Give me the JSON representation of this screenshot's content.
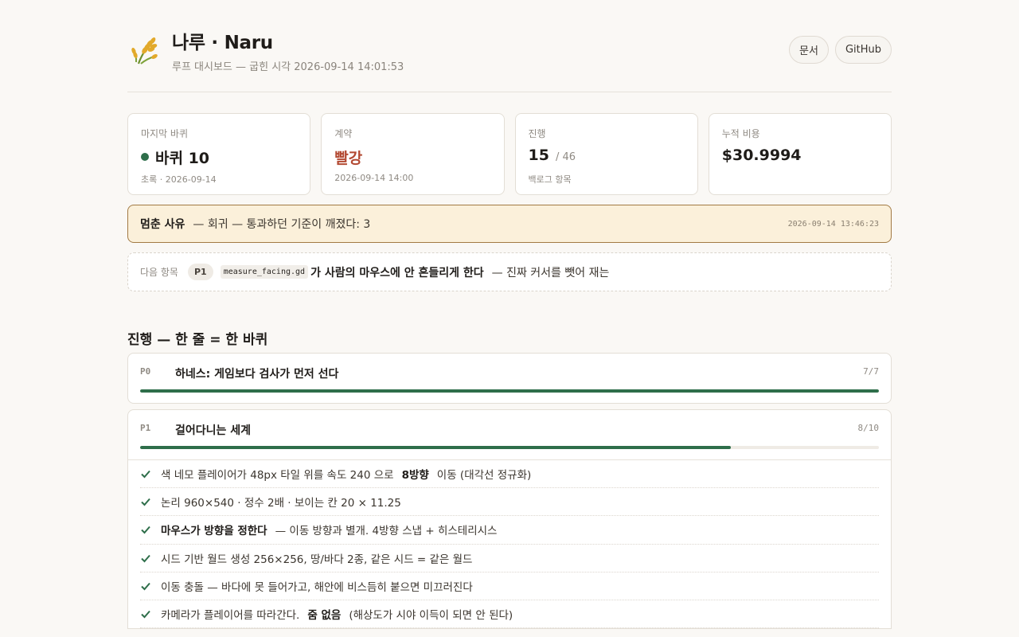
{
  "header": {
    "title": "나루 · Naru",
    "subtitle": "루프 대시보드 — 굽힌 시각 2026-09-14 14:01:53",
    "buttons": {
      "docs": "문서",
      "github": "GitHub"
    }
  },
  "cards": {
    "last_wheel": {
      "label": "마지막 바퀴",
      "value": "바퀴 10",
      "sub": "초록 · 2026-09-14",
      "status_color": "#2e6e4a"
    },
    "contract": {
      "label": "계약",
      "value": "빨강",
      "sub": "2026-09-14 14:00",
      "value_color": "#b34a33"
    },
    "progress": {
      "label": "진행",
      "value": "15",
      "total": "/ 46",
      "sub": "백로그 항목"
    },
    "cost": {
      "label": "누적 비용",
      "value": "$30.9994"
    }
  },
  "stop": {
    "label": "멈춘 사유",
    "text": "— 회귀 — 통과하던 기준이 깨졌다: 3",
    "time": "2026-09-14 13:46:23"
  },
  "next": {
    "label": "다음 항목",
    "priority": "P1",
    "code": "measure_facing.gd",
    "strong": "가 사람의 마우스에 안 흔들리게 한다",
    "rest": "— 진짜 커서를 뺏어 재는"
  },
  "progress_section": {
    "title": "진행 — 한 줄 = 한 바퀴",
    "phases": [
      {
        "tag": "P0",
        "name": "하네스: 게임보다 검사가 먼저 선다",
        "count": "7/7",
        "done": 7,
        "total": 7
      },
      {
        "tag": "P1",
        "name": "걸어다니는 세계",
        "count": "8/10",
        "done": 8,
        "total": 10
      }
    ],
    "tasks": [
      {
        "pre": "색 네모 플레이어가 48px 타일 위를 속도 240 으로",
        "bold": "8방향",
        "post": "이동 (대각선 정규화)"
      },
      {
        "pre": "논리 960×540 · 정수 2배 · 보이는 칸 20 × 11.25",
        "bold": "",
        "post": ""
      },
      {
        "pre": "",
        "bold": "마우스가 방향을 정한다",
        "post": "— 이동 방향과 별개. 4방향 스냅 + 히스테리시스"
      },
      {
        "pre": "시드 기반 월드 생성 256×256, 땅/바다 2종, 같은 시드 = 같은 월드",
        "bold": "",
        "post": ""
      },
      {
        "pre": "이동 충돌 — 바다에 못 들어가고, 해안에 비스듬히 붙으면 미끄러진다",
        "bold": "",
        "post": ""
      },
      {
        "pre": "카메라가 플레이어를 따라간다.",
        "bold": "줌 없음",
        "post": "(해상도가 시야 이득이 되면 안 된다)"
      }
    ]
  }
}
